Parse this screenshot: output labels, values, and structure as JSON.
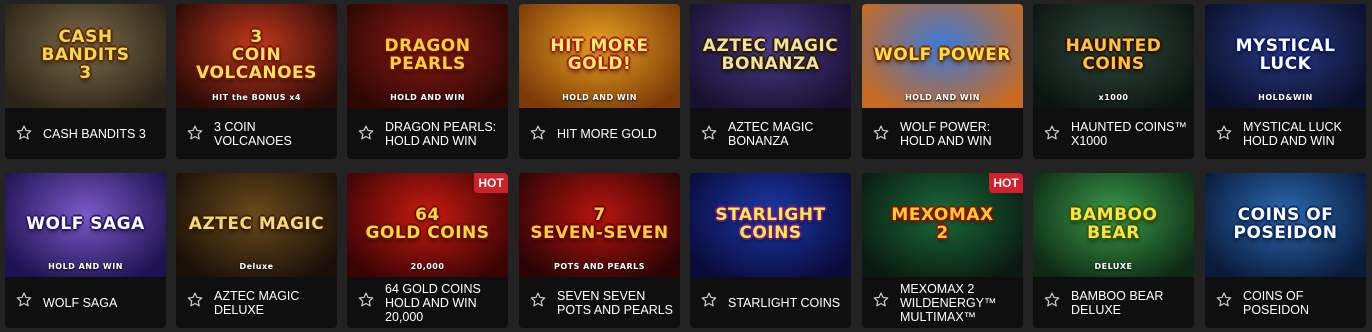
{
  "games": [
    {
      "name": "CASH BANDITS 3",
      "art_title": "CASH\nBANDITS\n3",
      "art_sub": "",
      "hot": false,
      "bg": "#7a6a48",
      "bg2": "#2b2418",
      "title_color": "#f6d64a",
      "stroke": "#5a2a00"
    },
    {
      "name": "3 COIN VOLCANOES",
      "art_title": "3\nCOIN\nVOLCANOES",
      "art_sub": "HIT the BONUS x4",
      "hot": false,
      "bg": "#c2381e",
      "bg2": "#2a0a06",
      "title_color": "#ffe25a",
      "stroke": "#7a1400"
    },
    {
      "name": "DRAGON PEARLS: HOLD AND WIN",
      "art_title": "DRAGON\nPEARLS",
      "art_sub": "HOLD AND WIN",
      "hot": false,
      "bg": "#8b1a12",
      "bg2": "#2c0704",
      "title_color": "#ffcf3a",
      "stroke": "#6b1200"
    },
    {
      "name": "HIT MORE GOLD",
      "art_title": "HIT MORE GOLD!",
      "art_sub": "HOLD AND WIN",
      "hot": false,
      "bg": "#e8a020",
      "bg2": "#7a3a08",
      "title_color": "#fff06a",
      "stroke": "#b01818"
    },
    {
      "name": "AZTEC MAGIC BONANZA",
      "art_title": "AZTEC MAGIC\nBONANZA",
      "art_sub": "",
      "hot": false,
      "bg": "#4a3a8c",
      "bg2": "#1a1030",
      "title_color": "#f2e2a0",
      "stroke": "#2a1a00"
    },
    {
      "name": "WOLF POWER: HOLD AND WIN",
      "art_title": "WOLF POWER",
      "art_sub": "HOLD AND WIN",
      "hot": false,
      "bg": "#3a7ad8",
      "bg2": "#c86a20",
      "title_color": "#ffe04a",
      "stroke": "#7a3000"
    },
    {
      "name": "HAUNTED COINS™ X1000",
      "art_title": "HAUNTED\nCOINS",
      "art_sub": "x1000",
      "hot": false,
      "bg": "#2e4a3a",
      "bg2": "#0c1410",
      "title_color": "#ffc23a",
      "stroke": "#2a1200"
    },
    {
      "name": "MYSTICAL LUCK HOLD AND WIN",
      "art_title": "MYSTICAL LUCK",
      "art_sub": "HOLD&WIN",
      "hot": false,
      "bg": "#2a3c86",
      "bg2": "#0a0f2a",
      "title_color": "#ffffff",
      "stroke": "#0a1a6a"
    },
    {
      "name": "WOLF SAGA",
      "art_title": "WOLF SAGA",
      "art_sub": "HOLD AND WIN",
      "hot": false,
      "bg": "#7a5ac8",
      "bg2": "#1e1250",
      "title_color": "#ffffff",
      "stroke": "#2a1870"
    },
    {
      "name": "AZTEC MAGIC DELUXE",
      "art_title": "Aztec Magic",
      "art_sub": "Deluxe",
      "hot": false,
      "bg": "#6a4a1a",
      "bg2": "#1a1008",
      "title_color": "#f6d676",
      "stroke": "#3a2000"
    },
    {
      "name": "64 GOLD COINS HOLD AND WIN 20,000",
      "art_title": "64\nGOLD COINS",
      "art_sub": "20,000",
      "hot": true,
      "bg": "#c81a10",
      "bg2": "#3a0404",
      "title_color": "#ffd83a",
      "stroke": "#6a0c00"
    },
    {
      "name": "SEVEN SEVEN POTS AND PEARLS",
      "art_title": "7\nSEVEN-SEVEN",
      "art_sub": "POTS AND PEARLS",
      "hot": false,
      "bg": "#b81410",
      "bg2": "#2a0404",
      "title_color": "#ffd23a",
      "stroke": "#6a0000"
    },
    {
      "name": "STARLIGHT COINS",
      "art_title": "STARLIGHT\nCOINS",
      "art_sub": "",
      "hot": false,
      "bg": "#1a3aa8",
      "bg2": "#0a0a3a",
      "title_color": "#ffe84a",
      "stroke": "#6a1a8a"
    },
    {
      "name": "MEXOMAX 2 WILDENERGY™ MULTIMAX™",
      "art_title": "MEXOMAX\n2",
      "art_sub": "",
      "hot": true,
      "bg": "#1a6a3a",
      "bg2": "#0a1a10",
      "title_color": "#ffcc2a",
      "stroke": "#8a1000"
    },
    {
      "name": "BAMBOO BEAR DELUXE",
      "art_title": "BAMBOO\nBEAR",
      "art_sub": "DELUXE",
      "hot": false,
      "bg": "#3a9a4a",
      "bg2": "#0e2a14",
      "title_color": "#ffe23a",
      "stroke": "#2a5a10"
    },
    {
      "name": "COINS OF POSEIDON",
      "art_title": "COINS OF\nPOSEIDON",
      "art_sub": "",
      "hot": false,
      "bg": "#2a6ab0",
      "bg2": "#0a1a3a",
      "title_color": "#ffffff",
      "stroke": "#0a2a6a"
    }
  ],
  "hot_label": "HOT",
  "icons": {
    "favorite": "star-outline-icon"
  },
  "colors": {
    "page_bg": "#232323",
    "card_bg": "#0f0f0f",
    "hot_badge": "#d0202a",
    "text": "#ffffff",
    "star": "#cfcfcf"
  }
}
